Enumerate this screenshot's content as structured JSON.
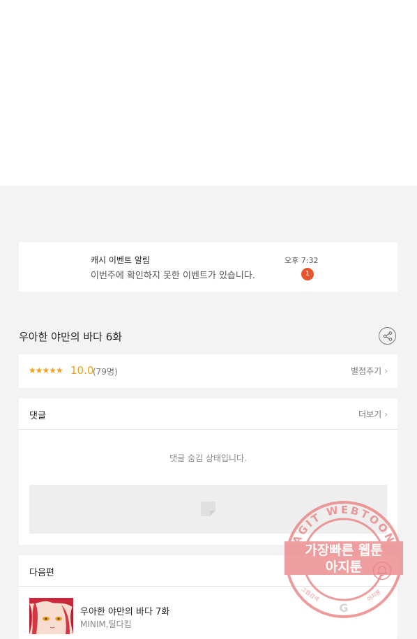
{
  "notification": {
    "title": "캐시 이벤트 알림",
    "message": "이번주에 확인하지 못한 이벤트가 있습니다.",
    "time": "오후 7:32",
    "badge": "1"
  },
  "episode": {
    "title": "우아한 야만의 바다 6화",
    "share_icon": "share-icon"
  },
  "rating": {
    "stars": "★★★★★",
    "score": "10.0",
    "count": "(79명)",
    "rate_label": "별점주기"
  },
  "comments": {
    "label": "댓글",
    "more_label": "더보기",
    "hidden_message": "댓글 숨김 상태입니다."
  },
  "next": {
    "label": "다음편",
    "episode_title": "우아한 야만의 바다 7화",
    "authors": "MINIM,틸다킴"
  },
  "watermark": {
    "arc_text": "AGIT WEBTOON",
    "line1": "가장빠른 웹툰",
    "line2": "아지툰",
    "bottom_left": "그웹검색",
    "bottom_right": "아지툰"
  },
  "colors": {
    "accent": "#f0a21b",
    "badge": "#e8542e",
    "stamp": "#e98585"
  }
}
